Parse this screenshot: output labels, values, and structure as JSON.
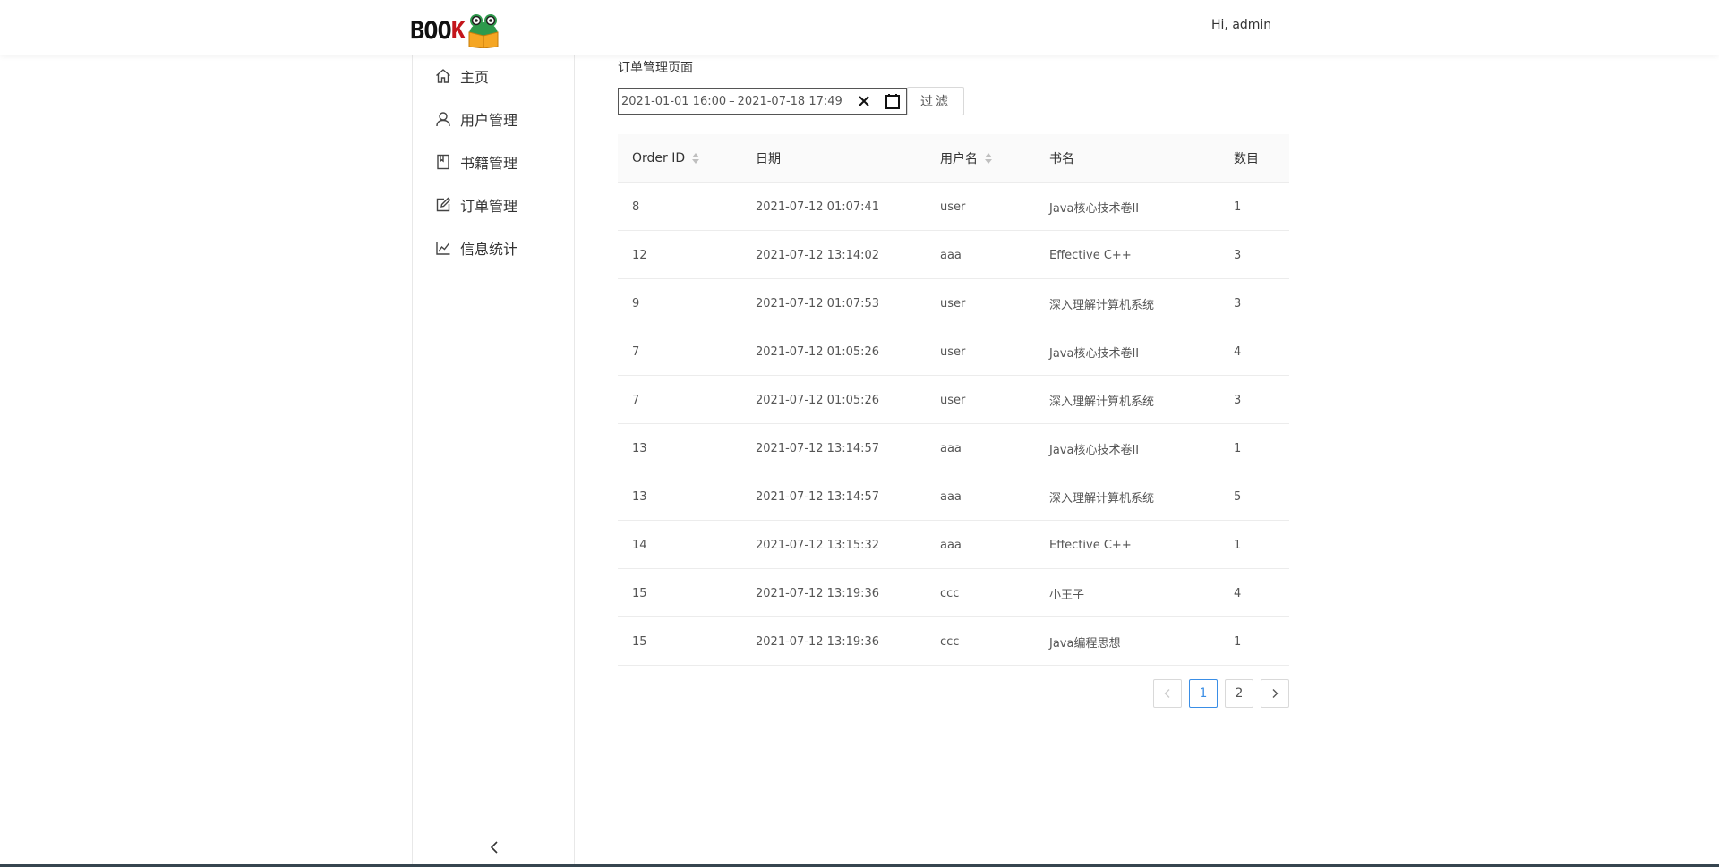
{
  "header": {
    "logo_text_main": "BOO",
    "logo_text_k": "K",
    "greeting": "Hi,  admin"
  },
  "sidebar": {
    "items": [
      {
        "label": "主页",
        "icon": "home-icon"
      },
      {
        "label": "用户管理",
        "icon": "user-icon"
      },
      {
        "label": "书籍管理",
        "icon": "book-icon"
      },
      {
        "label": "订单管理",
        "icon": "edit-icon"
      },
      {
        "label": "信息统计",
        "icon": "line-chart-icon"
      }
    ],
    "collapse_icon": "chevron-left-icon"
  },
  "main": {
    "title": "订单管理页面",
    "range_picker": {
      "start": "2021-01-01  16:00",
      "separator": "–",
      "end": "2021-07-18  17:49"
    },
    "filter_label": "过滤"
  },
  "table": {
    "columns": [
      "Order ID",
      "日期",
      "用户名",
      "书名",
      "数目"
    ],
    "rows": [
      [
        "8",
        "2021-07-12 01:07:41",
        "user",
        "Java核心技术卷II",
        "1"
      ],
      [
        "12",
        "2021-07-12 13:14:02",
        "aaa",
        "Effective C++",
        "3"
      ],
      [
        "9",
        "2021-07-12 01:07:53",
        "user",
        "深入理解计算机系统",
        "3"
      ],
      [
        "7",
        "2021-07-12 01:05:26",
        "user",
        "Java核心技术卷II",
        "4"
      ],
      [
        "7",
        "2021-07-12 01:05:26",
        "user",
        "深入理解计算机系统",
        "3"
      ],
      [
        "13",
        "2021-07-12 13:14:57",
        "aaa",
        "Java核心技术卷II",
        "1"
      ],
      [
        "13",
        "2021-07-12 13:14:57",
        "aaa",
        "深入理解计算机系统",
        "5"
      ],
      [
        "14",
        "2021-07-12 13:15:32",
        "aaa",
        "Effective C++",
        "1"
      ],
      [
        "15",
        "2021-07-12 13:19:36",
        "ccc",
        "小王子",
        "4"
      ],
      [
        "15",
        "2021-07-12 13:19:36",
        "ccc",
        "Java编程思想",
        "1"
      ]
    ]
  },
  "pagination": {
    "pages": [
      "1",
      "2"
    ],
    "current": "1"
  },
  "colors": {
    "accent": "#3a8ee6",
    "logo_k": "#c4161c"
  }
}
